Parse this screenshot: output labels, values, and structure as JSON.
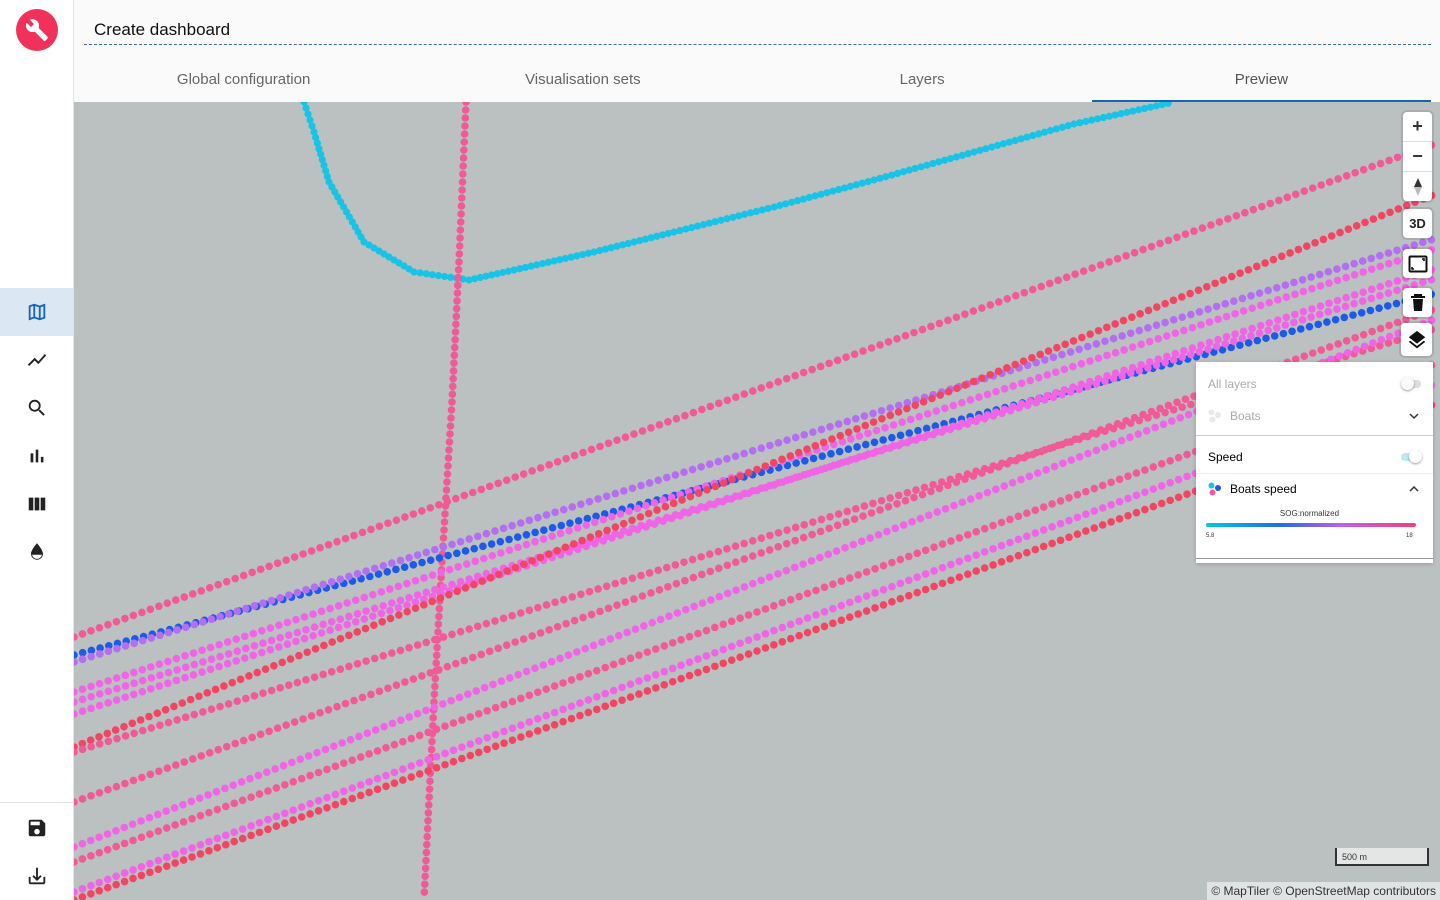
{
  "header": {
    "title": "Create dashboard",
    "tabs": [
      {
        "label": "Global configuration"
      },
      {
        "label": "Visualisation sets"
      },
      {
        "label": "Layers"
      },
      {
        "label": "Preview",
        "active": true
      }
    ]
  },
  "sidebar": {
    "logo_icon": "wrench-icon",
    "items": [
      {
        "icon": "map-icon",
        "active": true
      },
      {
        "icon": "line-chart-icon"
      },
      {
        "icon": "search-icon"
      },
      {
        "icon": "bar-chart-icon"
      },
      {
        "icon": "columns-icon"
      },
      {
        "icon": "drop-icon"
      }
    ],
    "bottom_items": [
      {
        "icon": "save-icon"
      },
      {
        "icon": "download-icon"
      }
    ]
  },
  "map": {
    "controls": {
      "zoom_in": "+",
      "zoom_out": "−",
      "three_d": "3D"
    },
    "layers_panel": {
      "all_layers_label": "All layers",
      "boats_label": "Boats",
      "speed_label": "Speed",
      "boats_speed_label": "Boats speed",
      "legend_title": "SOG:normalized",
      "legend_min": "5.8",
      "legend_max": "18"
    },
    "scale_label": "500 m",
    "attribution": "© MapTiler © OpenStreetMap contributors",
    "colors": {
      "background": "#bbc0c1",
      "cyan": "#19c3e6",
      "blue": "#1e5ae6",
      "purple": "#b46ef0",
      "magenta": "#f064e6",
      "pink": "#f05a96",
      "red": "#f04664"
    }
  }
}
